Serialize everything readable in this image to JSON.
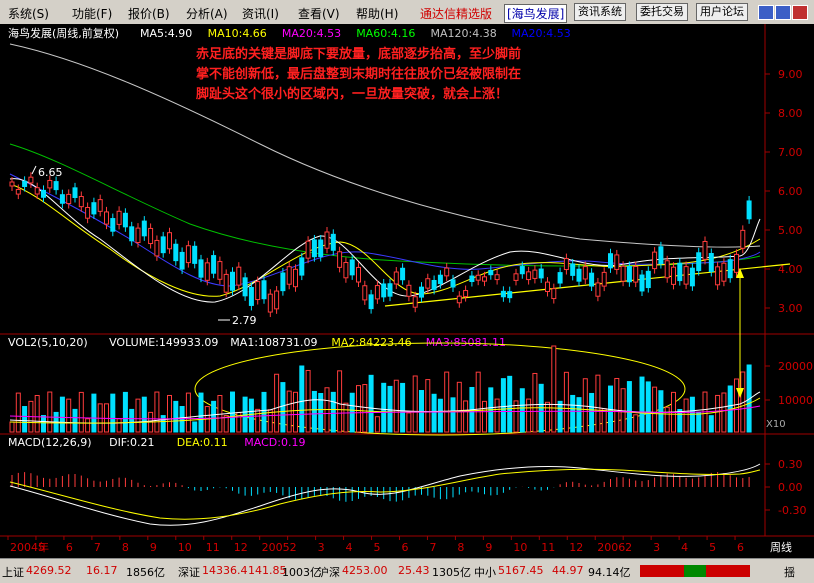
{
  "menu": {
    "items": [
      "系统(S)",
      "功能(F)",
      "报价(B)",
      "分析(A)",
      "资讯(I)",
      "查看(V)",
      "帮助(H)"
    ],
    "brand": "通达信精选版",
    "stock": "[海鸟发展]",
    "buttons": [
      "资讯系统",
      "委托交易",
      "用户论坛"
    ]
  },
  "price_panel": {
    "header": "海鸟发展(周线,前复权)",
    "ma_labels": [
      {
        "text": "MA5:4.90",
        "color": "#ffffff"
      },
      {
        "text": "MA10:4.66",
        "color": "#ffff00"
      },
      {
        "text": "MA20:4.53",
        "color": "#ff00ff"
      },
      {
        "text": "MA60:4.16",
        "color": "#00ff00"
      },
      {
        "text": "MA120:4.38",
        "color": "#c0c0c0"
      },
      {
        "text": "MA20:4.53",
        "color": "#0000ff"
      }
    ],
    "annotation": [
      "赤足底的关键是脚底下要放量，底部逐步抬高，至少脚前",
      "掌不能创新低，最后盘整到末期时往往股价已经被限制在",
      "脚趾头这个很小的区域内，一旦放量突破，就会上涨！"
    ],
    "high_label": "6.65",
    "low_label": "2.79",
    "y_ticks": [
      "9.00",
      "8.00",
      "7.00",
      "6.00",
      "5.00",
      "4.00",
      "3.00"
    ]
  },
  "volume_panel": {
    "header": [
      {
        "text": "VOL2(5,10,20)",
        "color": "#ffffff"
      },
      {
        "text": "VOLUME:149933.09",
        "color": "#ffffff"
      },
      {
        "text": "MA1:108731.09",
        "color": "#ffffff"
      },
      {
        "text": "MA2:84223.46",
        "color": "#ffff00"
      },
      {
        "text": "MA3:85081.11",
        "color": "#ff00ff"
      }
    ],
    "y_ticks": [
      "20000",
      "10000"
    ],
    "multiplier": "X10"
  },
  "macd_panel": {
    "header": [
      {
        "text": "MACD(12,26,9)",
        "color": "#ffffff"
      },
      {
        "text": "DIF:0.21",
        "color": "#ffffff"
      },
      {
        "text": "DEA:0.11",
        "color": "#ffff00"
      },
      {
        "text": "MACD:0.19",
        "color": "#ff00ff"
      }
    ],
    "y_ticks": [
      "0.30",
      "0.00",
      "-0.30"
    ]
  },
  "x_axis": {
    "labels": [
      "2004年",
      "5",
      "6",
      "7",
      "8",
      "9",
      "10",
      "11",
      "12",
      "2005",
      "2",
      "3",
      "4",
      "5",
      "6",
      "7",
      "8",
      "9",
      "10",
      "11",
      "12",
      "2006",
      "2",
      "3",
      "4",
      "5",
      "6"
    ],
    "period": "周线"
  },
  "status_bar": {
    "items": [
      {
        "label": "上证",
        "value": "4269.52",
        "change": "16.17",
        "amount": "1856亿"
      },
      {
        "label": "深证",
        "value": "14336.4",
        "change": "141.85",
        "amount": "1003亿"
      },
      {
        "label": "沪深",
        "value": "4253.00",
        "change": "25.43",
        "amount": "1305亿"
      },
      {
        "label": "中小",
        "value": "5167.45",
        "change": "44.97",
        "amount": "94.14亿"
      }
    ],
    "end_label": "揺"
  },
  "colors": {
    "up": "#ff3c3c",
    "down": "#00e0ff",
    "ma5": "#ffffff",
    "ma10": "#ffff00",
    "ma20": "#ff00ff",
    "ma60": "#00c000",
    "ma120": "#c8c8c8",
    "blue_ma": "#3b3bff",
    "annotation": "#ff2020"
  }
}
